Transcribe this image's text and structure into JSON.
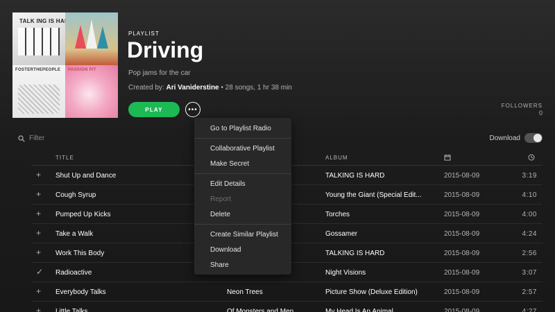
{
  "cover": {
    "tile1_text": "TALK  ING  IS  HARD",
    "tile3_text": "FOSTERTHEPEOPLE",
    "tile4_text": "PASSION PIT"
  },
  "header": {
    "type_label": "PLAYLIST",
    "title": "Driving",
    "description": "Pop jams for the car",
    "created_by_label": "Created by:",
    "owner": "Ari Vaniderstine",
    "stats": "• 28 songs, 1 hr 38 min",
    "play_label": "PLAY",
    "more_glyph": "•••",
    "followers_label": "FOLLOWERS",
    "followers_count": "0"
  },
  "filter": {
    "placeholder": "Filter",
    "download_label": "Download",
    "download_enabled": false
  },
  "columns": {
    "title": "TITLE",
    "album": "ALBUM"
  },
  "tracks": [
    {
      "added": "+",
      "title": "Shut Up and Dance",
      "artist": "",
      "album": "TALKING IS HARD",
      "date": "2015-08-09",
      "duration": "3:19"
    },
    {
      "added": "+",
      "title": "Cough Syrup",
      "artist": "",
      "album": "Young the Giant (Special Edit...",
      "date": "2015-08-09",
      "duration": "4:10"
    },
    {
      "added": "+",
      "title": "Pumped Up Kicks",
      "artist": "",
      "album": "Torches",
      "date": "2015-08-09",
      "duration": "4:00"
    },
    {
      "added": "+",
      "title": "Take a Walk",
      "artist": "",
      "album": "Gossamer",
      "date": "2015-08-09",
      "duration": "4:24"
    },
    {
      "added": "+",
      "title": "Work This Body",
      "artist": "",
      "album": "TALKING IS HARD",
      "date": "2015-08-09",
      "duration": "2:56"
    },
    {
      "added": "✓",
      "title": "Radioactive",
      "artist": "",
      "album": "Night Visions",
      "date": "2015-08-09",
      "duration": "3:07"
    },
    {
      "added": "+",
      "title": "Everybody Talks",
      "artist": "Neon Trees",
      "album": "Picture Show (Deluxe Edition)",
      "date": "2015-08-09",
      "duration": "2:57"
    },
    {
      "added": "+",
      "title": "Little Talks",
      "artist": "Of Monsters and Men",
      "album": "My Head Is An Animal",
      "date": "2015-08-09",
      "duration": "4:27"
    }
  ],
  "menu": {
    "items": [
      {
        "label": "Go to Playlist Radio"
      },
      {
        "label": "Collaborative Playlist"
      },
      {
        "label": "Make Secret"
      },
      {
        "label": "Edit Details"
      },
      {
        "label": "Report"
      },
      {
        "label": "Delete"
      },
      {
        "label": "Create Similar Playlist"
      },
      {
        "label": "Download"
      },
      {
        "label": "Share"
      }
    ]
  },
  "colors": {
    "accent": "#1db954",
    "background": "#181818",
    "menu": "#282828"
  }
}
